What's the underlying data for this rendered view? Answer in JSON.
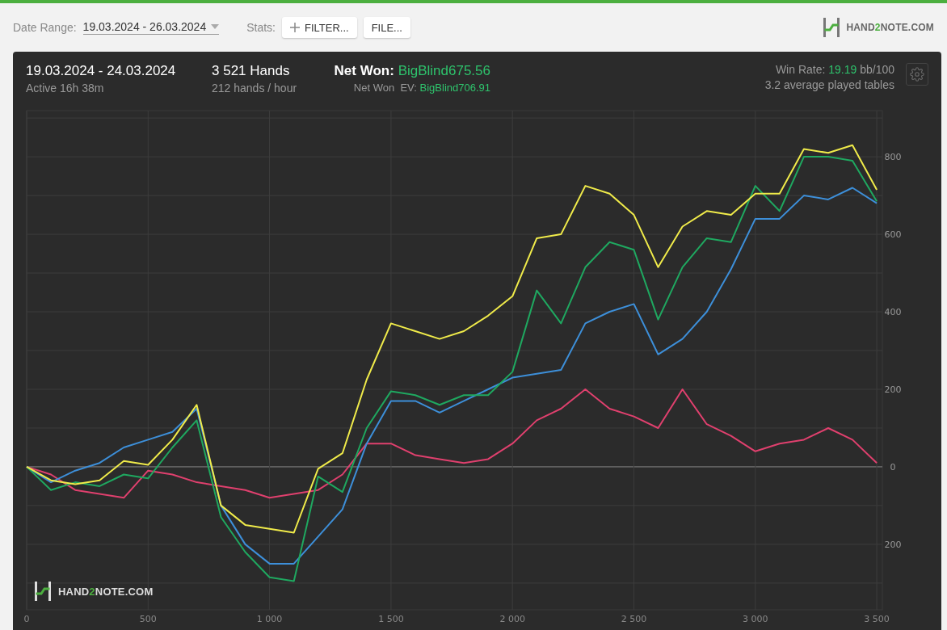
{
  "toolbar": {
    "date_range_label": "Date Range:",
    "date_range_value": "19.03.2024 - 26.03.2024",
    "stats_label": "Stats:",
    "buttons": [
      {
        "kind": "add",
        "label": "FILTER..."
      },
      {
        "kind": "plain",
        "label": "FILE..."
      }
    ]
  },
  "logo": {
    "before": "HAND",
    "accent": "2",
    "after": "NOTE.COM"
  },
  "summary": {
    "period": "19.03.2024 - 24.03.2024",
    "active": "Active 16h 38m",
    "hands": "3 521 Hands",
    "hands_rate": "212 hands / hour",
    "net_won_label": "Net Won:",
    "net_won_value": "BigBlind675.56",
    "net_won_ev_label": "Net Won  EV:",
    "net_won_ev_value": "BigBlind706.91",
    "win_rate_label": "Win Rate:",
    "win_rate_value": "19.19",
    "win_rate_unit": "bb/100",
    "tables": "3.2 average played tables"
  },
  "chart": {
    "watermark": {
      "before": "HAND",
      "accent": "2",
      "after": "NOTE.COM"
    },
    "chart_data": {
      "type": "line",
      "grid": true,
      "x": [
        0,
        100,
        200,
        300,
        400,
        500,
        600,
        700,
        800,
        900,
        1000,
        1100,
        1200,
        1300,
        1400,
        1500,
        1600,
        1700,
        1800,
        1900,
        2000,
        2100,
        2200,
        2300,
        2400,
        2500,
        2600,
        2700,
        2800,
        2900,
        3000,
        3100,
        3200,
        3300,
        3400,
        3500
      ],
      "xlim": [
        0,
        3523
      ],
      "ylim": [
        -369,
        919
      ],
      "xticks": [
        0,
        500,
        {
          "value": 1000,
          "label": "1 000"
        },
        {
          "value": 1500,
          "label": "1 500"
        },
        {
          "value": 2000,
          "label": "2 000"
        },
        {
          "value": 2500,
          "label": "2 500"
        },
        {
          "value": 3000,
          "label": "3 000"
        },
        {
          "value": 3500,
          "label": "3 500"
        }
      ],
      "yticks": [
        {
          "value": -200,
          "label": "200"
        },
        0,
        200,
        400,
        600,
        800
      ],
      "series": [
        {
          "color": "#e0406e",
          "values": [
            0,
            -20,
            -60,
            -70,
            -80,
            -10,
            -20,
            -40,
            -50,
            -60,
            -80,
            -70,
            -60,
            -20,
            60,
            60,
            30,
            20,
            10,
            20,
            60,
            120,
            150,
            200,
            150,
            130,
            100,
            200,
            110,
            80,
            40,
            60,
            70,
            100,
            70,
            10
          ]
        },
        {
          "color": "#3d8fd9",
          "values": [
            0,
            -40,
            -10,
            10,
            50,
            70,
            90,
            150,
            -100,
            -200,
            -250,
            -250,
            -180,
            -110,
            60,
            170,
            170,
            140,
            170,
            200,
            230,
            240,
            250,
            370,
            400,
            420,
            290,
            330,
            400,
            510,
            640,
            640,
            700,
            690,
            720,
            680
          ]
        },
        {
          "color": "#1fa860",
          "values": [
            0,
            -60,
            -40,
            -50,
            -20,
            -30,
            50,
            120,
            -130,
            -220,
            -285,
            -295,
            -25,
            -65,
            100,
            195,
            185,
            160,
            185,
            185,
            245,
            455,
            370,
            515,
            580,
            560,
            380,
            515,
            590,
            580,
            725,
            660,
            800,
            800,
            790,
            685
          ]
        },
        {
          "color": "#f0eb4a",
          "values": [
            0,
            -35,
            -45,
            -35,
            15,
            5,
            70,
            160,
            -100,
            -150,
            -160,
            -170,
            -5,
            35,
            225,
            370,
            350,
            330,
            350,
            390,
            440,
            590,
            600,
            725,
            705,
            650,
            515,
            620,
            660,
            650,
            705,
            705,
            820,
            810,
            830,
            715
          ]
        }
      ]
    }
  }
}
